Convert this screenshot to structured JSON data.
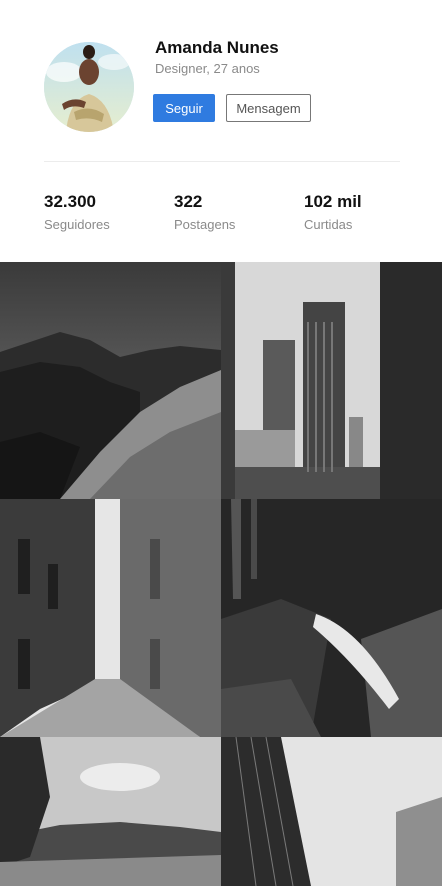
{
  "profile": {
    "name": "Amanda Nunes",
    "subtitle": "Designer, 27 anos",
    "follow_label": "Seguir",
    "message_label": "Mensagem"
  },
  "stats": [
    {
      "value": "32.300",
      "label": "Seguidores"
    },
    {
      "value": "322",
      "label": "Postagens"
    },
    {
      "value": "102 mil",
      "label": "Curtidas"
    }
  ],
  "colors": {
    "accent": "#2f7be0",
    "muted_text": "#8a8a8a"
  },
  "gallery": [
    {
      "subject": "mountain-landscape"
    },
    {
      "subject": "city-skyscrapers"
    },
    {
      "subject": "narrow-alley"
    },
    {
      "subject": "waterfall-rocks"
    },
    {
      "subject": "hill-with-flowers"
    },
    {
      "subject": "glass-buildings"
    }
  ]
}
